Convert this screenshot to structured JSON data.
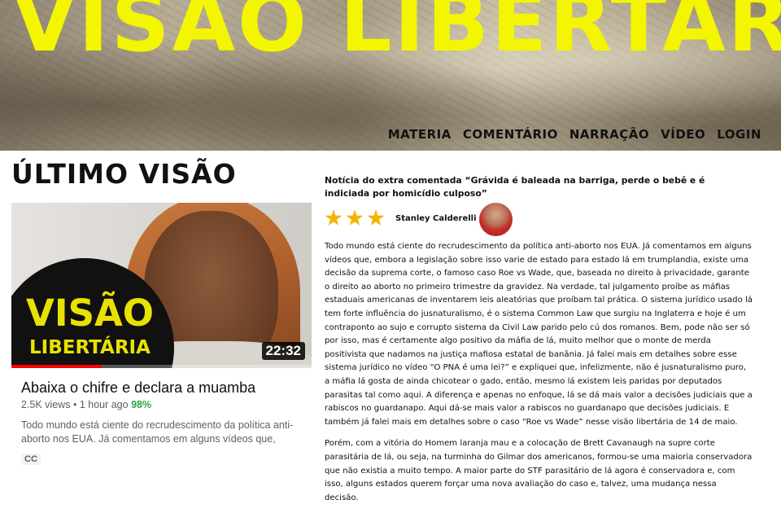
{
  "header": {
    "site_title": "VISÃO LIBERTÁRIA",
    "nav": [
      "MATERIA",
      "COMENTÁRIO",
      "NARRAÇÃO",
      "VÍDEO",
      "LOGIN"
    ]
  },
  "left": {
    "section_title": "ÚLTIMO VISÃO",
    "video": {
      "thumbnail_brand_line1": "VISÃO",
      "thumbnail_brand_line2": "LIBERTÁRIA",
      "duration": "22:32",
      "watched_fraction": 0.3,
      "title": "Abaixa o chifre e declara a muamba",
      "views": "2.5K views",
      "separator": "•",
      "age": "1 hour ago",
      "like_pct": "98%",
      "description": "Todo mundo está ciente do recrudescimento da política anti-aborto nos EUA. Já comentamos em alguns vídeos que, embora a legislação sobre isso varie de estado para estado",
      "cc_badge": "CC"
    }
  },
  "article": {
    "title": "Notícia do extra comentada “Grávida é baleada na barriga, perde o bebê e é indiciada por homicídio culposo”",
    "rating": 3,
    "author": "Stanley Calderelli",
    "paragraphs": [
      "Todo mundo está ciente do recrudescimento da política anti-aborto nos EUA. Já comentamos em alguns vídeos que, embora a legislação sobre isso varie de estado para estado lá em trumplandia, existe uma decisão da suprema corte, o famoso caso Roe vs Wade, que, baseada no direito à privacidade, garante o direito ao aborto no primeiro trimestre da gravidez. Na verdade, tal julgamento proíbe as máfias estaduais americanas de inventarem leis aleatórias que proíbam tal prática. O sistema jurídico usado lá tem forte influência do jusnaturalismo, é o sistema Common Law que surgiu na Inglaterra e hoje é um contraponto ao sujo e corrupto sistema da Civil Law parido pelo cú dos romanos. Bem, pode não ser só por isso, mas é certamente algo positivo da máfia de lá, muito melhor que o monte de merda positivista que nadamos na justiça mafiosa estatal de banânia. Já falei mais em detalhes sobre esse sistema jurídico no vídeo “O PNA é uma lei?” e expliquei que, infelizmente, não é jusnaturalismo puro, a máfia lá gosta de ainda chicotear o gado, então, mesmo lá existem leis paridas por deputados parasitas tal como aqui. A diferença e apenas no enfoque, lá se dá mais valor a decisões judiciais que a rabiscos no guardanapo. Aqui dá-se mais valor a rabiscos no guardanapo que decisões judiciais. E também já falei mais em detalhes sobre o caso “Roe vs Wade” nesse visão libertária de 14 de maio.",
      "Porém, com a vitória do Homem laranja mau e a colocação de Brett Cavanaugh na supre corte parasitária de lá, ou seja, na turminha do Gilmar dos americanos, formou-se uma maioria conservadora que não existia a muito tempo. A maior parte do STF parasitário de lá agora é conservadora e, com isso, alguns estados querem forçar uma nova avaliação do caso e, talvez, uma mudança nessa decisão."
    ]
  },
  "colors": {
    "title_yellow": "#f4f500",
    "star": "#f4b400",
    "like_green": "#2ba640",
    "progress_red": "#ff0000"
  }
}
